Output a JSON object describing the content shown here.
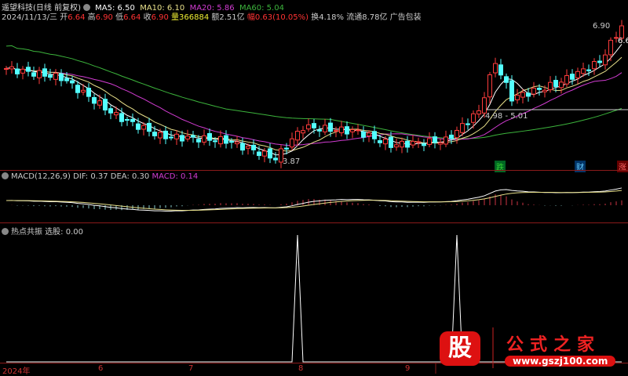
{
  "header": {
    "stock": "遥望科技(日线 前复权)",
    "ma5": "MA5: 6.50",
    "ma10": "MA10: 6.10",
    "ma20": "MA20: 5.86",
    "ma60": "MA60: 5.04",
    "date": "2024/11/13/三",
    "open_l": "开",
    "open": "6.64",
    "high_l": "高",
    "high": "6.90",
    "low_l": "低",
    "low": "6.64",
    "close_l": "收",
    "close": "6.90",
    "vol_l": "量",
    "vol": "366884",
    "amt": "额2.51亿",
    "chg_l": "幅",
    "chg": "0.63(10.05%)",
    "turn": "换4.18%",
    "float": "流通8.78亿",
    "ad": "广告包装"
  },
  "annotations": {
    "high": "6.90",
    "low": "3.87",
    "range": "4.98 - 5.01",
    "right_cut": "6.6",
    "mark_down": "跌",
    "mark_fin": "财",
    "mark_up": "涨"
  },
  "macd": {
    "title": "MACD(12,26,9)",
    "dif": "DIF: 0.37",
    "dea": "DEA: 0.30",
    "macd": "MACD: 0.14"
  },
  "signal": {
    "title": "热点共振",
    "value": "选股: 0.00",
    "spike_bars": [
      53,
      82
    ]
  },
  "xaxis": {
    "labels": [
      "2024年",
      "6",
      "7",
      "8",
      "9"
    ]
  },
  "watermark": {
    "logo": "股",
    "name": "公式之家",
    "url": "www.gszj100.com"
  },
  "colors": {
    "up": "#ff3c3c",
    "down": "#54ffff",
    "ma5": "#ffffff",
    "ma10": "#e8e08a",
    "ma20": "#d23cd2",
    "ma60": "#3cb43c"
  },
  "chart_data": {
    "type": "candlestick",
    "price_range": [
      3.87,
      6.9
    ],
    "close_keyframes": [
      [
        0,
        5.95
      ],
      [
        10,
        5.75
      ],
      [
        20,
        4.9
      ],
      [
        28,
        4.45
      ],
      [
        40,
        4.35
      ],
      [
        49,
        3.95
      ],
      [
        54,
        4.65
      ],
      [
        64,
        4.55
      ],
      [
        70,
        4.25
      ],
      [
        80,
        4.35
      ],
      [
        86,
        5.0
      ],
      [
        89,
        6.1
      ],
      [
        92,
        5.3
      ],
      [
        100,
        5.6
      ],
      [
        108,
        6.1
      ],
      [
        112,
        6.9
      ]
    ]
  }
}
